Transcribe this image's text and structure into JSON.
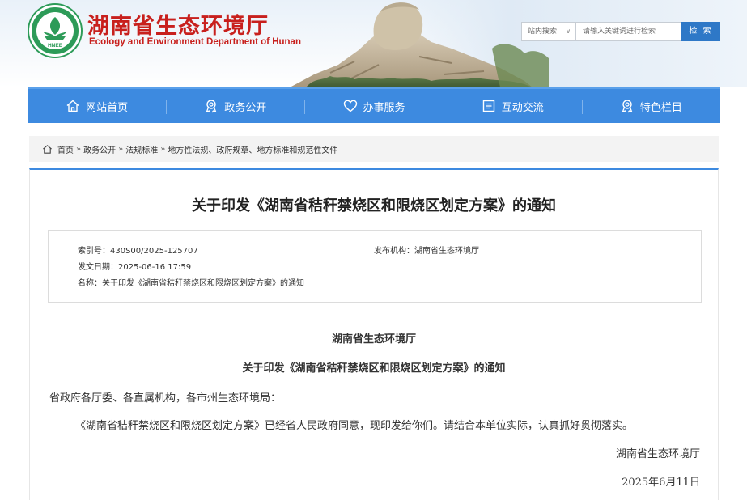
{
  "header": {
    "title_cn": "湖南省生态环境厅",
    "title_en": "Ecology and Environment Department of Hunan",
    "logo_text": "HNEE"
  },
  "search": {
    "scope_label": "站内搜索",
    "placeholder": "请输入关键词进行检索",
    "button_label": "检 索"
  },
  "nav": {
    "items": [
      {
        "label": "网站首页",
        "icon": "home-icon"
      },
      {
        "label": "政务公开",
        "icon": "award-icon"
      },
      {
        "label": "办事服务",
        "icon": "heart-icon"
      },
      {
        "label": "互动交流",
        "icon": "document-icon"
      },
      {
        "label": "特色栏目",
        "icon": "award-icon"
      }
    ]
  },
  "breadcrumb": {
    "items": [
      "首页",
      "政务公开",
      "法规标准",
      "地方性法规、政府规章、地方标准和规范性文件"
    ],
    "separator": "»"
  },
  "article": {
    "title": "关于印发《湖南省秸秆禁烧区和限烧区划定方案》的通知",
    "meta": {
      "index_label": "索引号：",
      "index_value": "430S00/2025-125707",
      "publisher_label": "发布机构：",
      "publisher_value": "湖南省生态环境厅",
      "date_label": "发文日期：",
      "date_value": "2025-06-16 17:59",
      "name_label": "名称：",
      "name_value": "关于印发《湖南省秸秆禁烧区和限烧区划定方案》的通知"
    },
    "body": {
      "issuer": "湖南省生态环境厅",
      "doc_title": "关于印发《湖南省秸秆禁烧区和限烧区划定方案》的通知",
      "recipients": "省政府各厅委、各直属机构，各市州生态环境局：",
      "paragraph": "《湖南省秸秆禁烧区和限烧区划定方案》已经省人民政府同意，现印发给你们。请结合本单位实际，认真抓好贯彻落实。",
      "signature": "湖南省生态环境厅",
      "date": "2025年6月11日"
    }
  },
  "colors": {
    "brand_red": "#c8201d",
    "nav_blue": "#3d8ae0",
    "search_button": "#2e78c7",
    "logo_green": "#2d9b58"
  }
}
